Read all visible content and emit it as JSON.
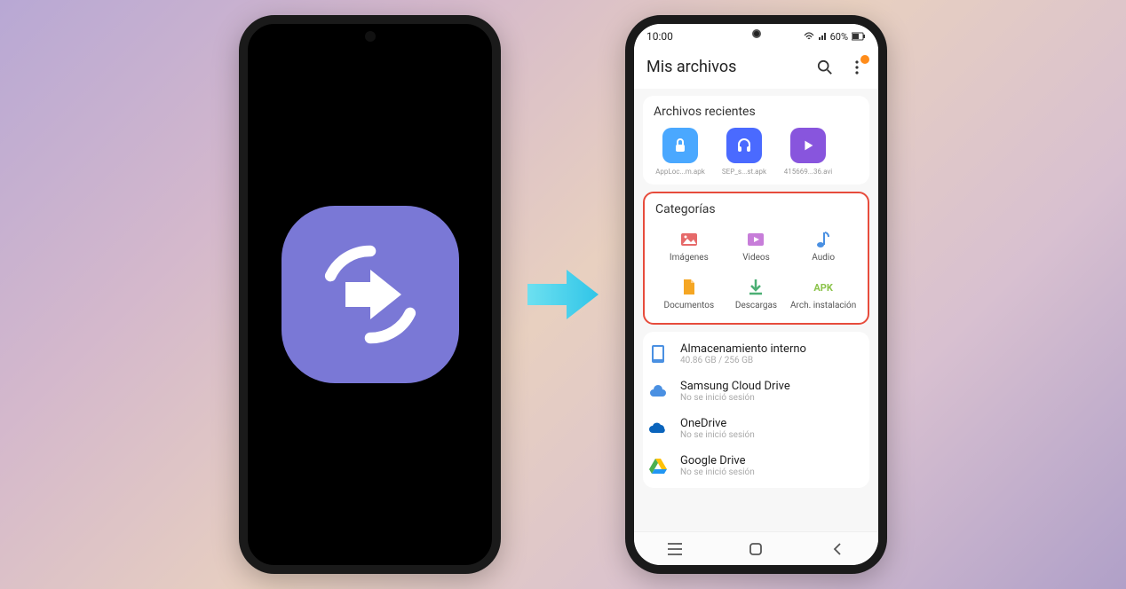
{
  "status": {
    "time": "10:00",
    "battery_text": "60%"
  },
  "appbar": {
    "title": "Mis archivos"
  },
  "recent": {
    "title": "Archivos recientes",
    "items": [
      {
        "label": "AppLoc...m.apk",
        "bg": "#4aa8ff"
      },
      {
        "label": "SEP_s...st.apk",
        "bg": "#4a6aff"
      },
      {
        "label": "415669...36.avi",
        "bg": "#8855dd"
      }
    ]
  },
  "categories": {
    "title": "Categorías",
    "items": [
      {
        "label": "Imágenes",
        "color": "#e66a6a"
      },
      {
        "label": "Videos",
        "color": "#c77dd9"
      },
      {
        "label": "Audio",
        "color": "#4a90e2"
      },
      {
        "label": "Documentos",
        "color": "#f5a623"
      },
      {
        "label": "Descargas",
        "color": "#4caf74"
      },
      {
        "label": "Arch. instalación",
        "color": "#8bc34a",
        "apk": "APK"
      }
    ]
  },
  "storage": {
    "items": [
      {
        "title": "Almacenamiento interno",
        "sub": "40.86 GB / 256 GB"
      },
      {
        "title": "Samsung Cloud Drive",
        "sub": "No se inició sesión"
      },
      {
        "title": "OneDrive",
        "sub": "No se inició sesión"
      },
      {
        "title": "Google Drive",
        "sub": "No se inició sesión"
      }
    ]
  }
}
